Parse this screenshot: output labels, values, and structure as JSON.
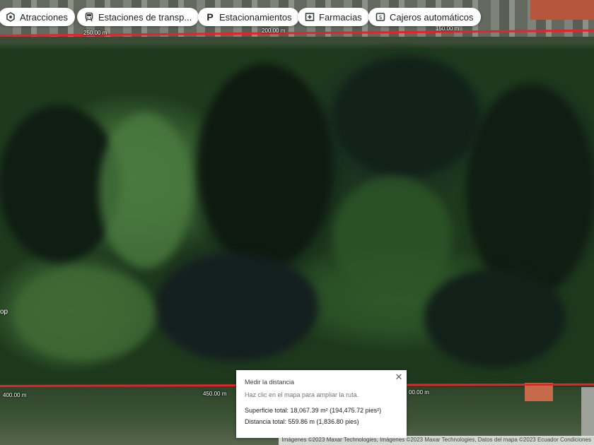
{
  "chips": [
    {
      "label": "Atracciones",
      "icon": "attraction-icon"
    },
    {
      "label": "Estaciones de transp...",
      "icon": "transit-icon"
    },
    {
      "label": "Estacionamientos",
      "icon": "parking-icon"
    },
    {
      "label": "Farmacias",
      "icon": "pharmacy-icon"
    },
    {
      "label": "Cajeros automáticos",
      "icon": "atm-icon"
    }
  ],
  "scale_labels": {
    "top_1": "250.00 m",
    "top_2": "200.00 m",
    "top_3": "150.00 m",
    "bottom_1": "400.00 m",
    "bottom_2": "450.00 m",
    "bottom_3": "00.00 m"
  },
  "side_label": "op",
  "measure_panel": {
    "title": "Medir la distancia",
    "hint": "Haz clic en el mapa para ampliar la ruta.",
    "area": "Superficie total: 18,067.39 m² (194,475.72 pies²)",
    "distance": "Distancia total: 559.86 m (1,836.80 pies)",
    "close_symbol": "✕"
  },
  "attribution": "Imágenes ©2023 Maxar Technologies, Imágenes ©2023 Maxar Technologies, Datos del mapa ©2023     Ecuador     Condiciones",
  "colors": {
    "measure_line": "#e8212b"
  }
}
